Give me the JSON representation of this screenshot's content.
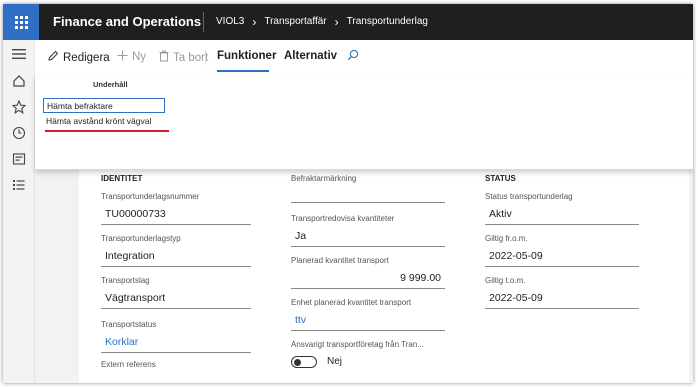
{
  "topbar": {
    "app_title": "Finance and Operations",
    "breadcrumbs": [
      "VIOL3",
      "Transportaffär",
      "Transportunderlag"
    ],
    "separator": "›"
  },
  "rail": {
    "icons": [
      "hamburger-icon",
      "home-icon",
      "star-icon",
      "clock-icon",
      "workspace-icon",
      "list-icon"
    ]
  },
  "actionbar": {
    "edit": "Redigera",
    "new": "Ny",
    "delete": "Ta bort",
    "functions": "Funktioner",
    "options": "Alternativ",
    "search": "search-icon"
  },
  "flyout": {
    "group_title": "Underhåll",
    "items": [
      "Hämta befraktare",
      "Hämta avstånd krönt vägval"
    ]
  },
  "form": {
    "identity": {
      "title": "IDENTITET",
      "fields": [
        {
          "label": "Transportunderlagsnummer",
          "value": "TU00000733"
        },
        {
          "label": "Transportunderlagstyp",
          "value": "Integration"
        },
        {
          "label": "Transportslag",
          "value": "Vägtransport"
        },
        {
          "label": "Transportstatus",
          "value": "Korklar"
        },
        {
          "label": "Extern referens",
          "value": ""
        }
      ]
    },
    "middle": {
      "fields": [
        {
          "label": "Befraktarmärkning",
          "value": ""
        },
        {
          "label": "Transportredovisa kvantiteter",
          "value": "Ja"
        },
        {
          "label": "Planerad kvantitet transport",
          "value": "9 999.00"
        },
        {
          "label": "Enhet planerad kvantitet transport",
          "value": "ttv"
        },
        {
          "label": "Ansvarigt transportföretag från Tran...",
          "value": "Nej"
        }
      ]
    },
    "status": {
      "title": "STATUS",
      "fields": [
        {
          "label": "Status transportunderlag",
          "value": "Aktiv"
        },
        {
          "label": "Giltig fr.o.m.",
          "value": "2022-05-09"
        },
        {
          "label": "Giltig t.o.m.",
          "value": "2022-05-09"
        }
      ]
    }
  },
  "colors": {
    "accent": "#2f6fc4",
    "topbar": "#1f1f1f",
    "highlight": "#d21e2b"
  }
}
